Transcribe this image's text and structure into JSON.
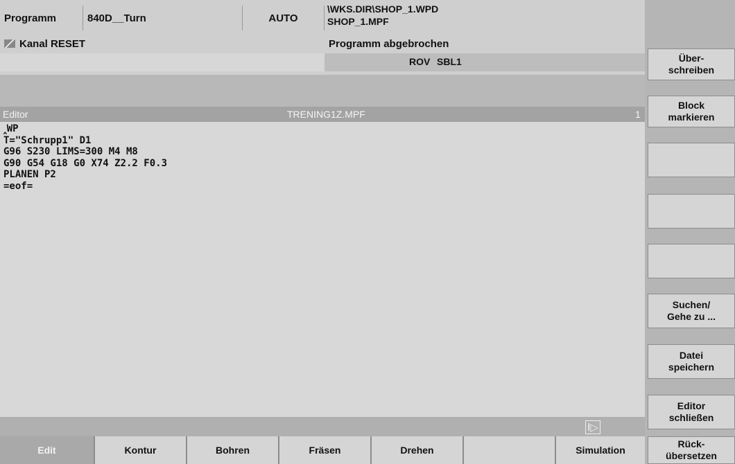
{
  "header": {
    "mode_label": "Programm",
    "machine": "840D__Turn",
    "op_mode": "AUTO",
    "path_line1": "\\WKS.DIR\\SHOP_1.WPD",
    "path_line2": "SHOP_1.MPF",
    "channel_status": "Kanal RESET",
    "program_status": "Programm abgebrochen",
    "flags": [
      "ROV",
      "SBL1"
    ]
  },
  "editor": {
    "label": "Editor",
    "filename": "TRENING1Z.MPF",
    "counter": "1",
    "lines": [
      "‸WP",
      "T=\"Schrupp1\" D1",
      "G96 S230 LIMS=300 M4 M8",
      "G90 G54 G18 G0 X74 Z2.2 F0.3",
      "PLANEN P2",
      "=eof="
    ],
    "page_indicator": "Ⅰ▷"
  },
  "right_softkeys": [
    {
      "label": "Über-\nschreiben"
    },
    {
      "label": "Block\nmarkieren"
    },
    {
      "label": ""
    },
    {
      "label": ""
    },
    {
      "label": ""
    },
    {
      "label": "Suchen/\nGehe zu ..."
    },
    {
      "label": "Datei\nspeichern"
    },
    {
      "label": "Editor\nschließen"
    },
    {
      "label": "Rück-\nübersetzen"
    }
  ],
  "bottom_softkeys": [
    {
      "label": "Edit",
      "active": true
    },
    {
      "label": "Kontur"
    },
    {
      "label": "Bohren"
    },
    {
      "label": "Fräsen"
    },
    {
      "label": "Drehen"
    },
    {
      "label": ""
    },
    {
      "label": "Simulation"
    }
  ],
  "colors": {
    "background": "#c9c9c9",
    "title_bar": "#a3a3a3",
    "active_softkey": "#a9a9a9"
  }
}
